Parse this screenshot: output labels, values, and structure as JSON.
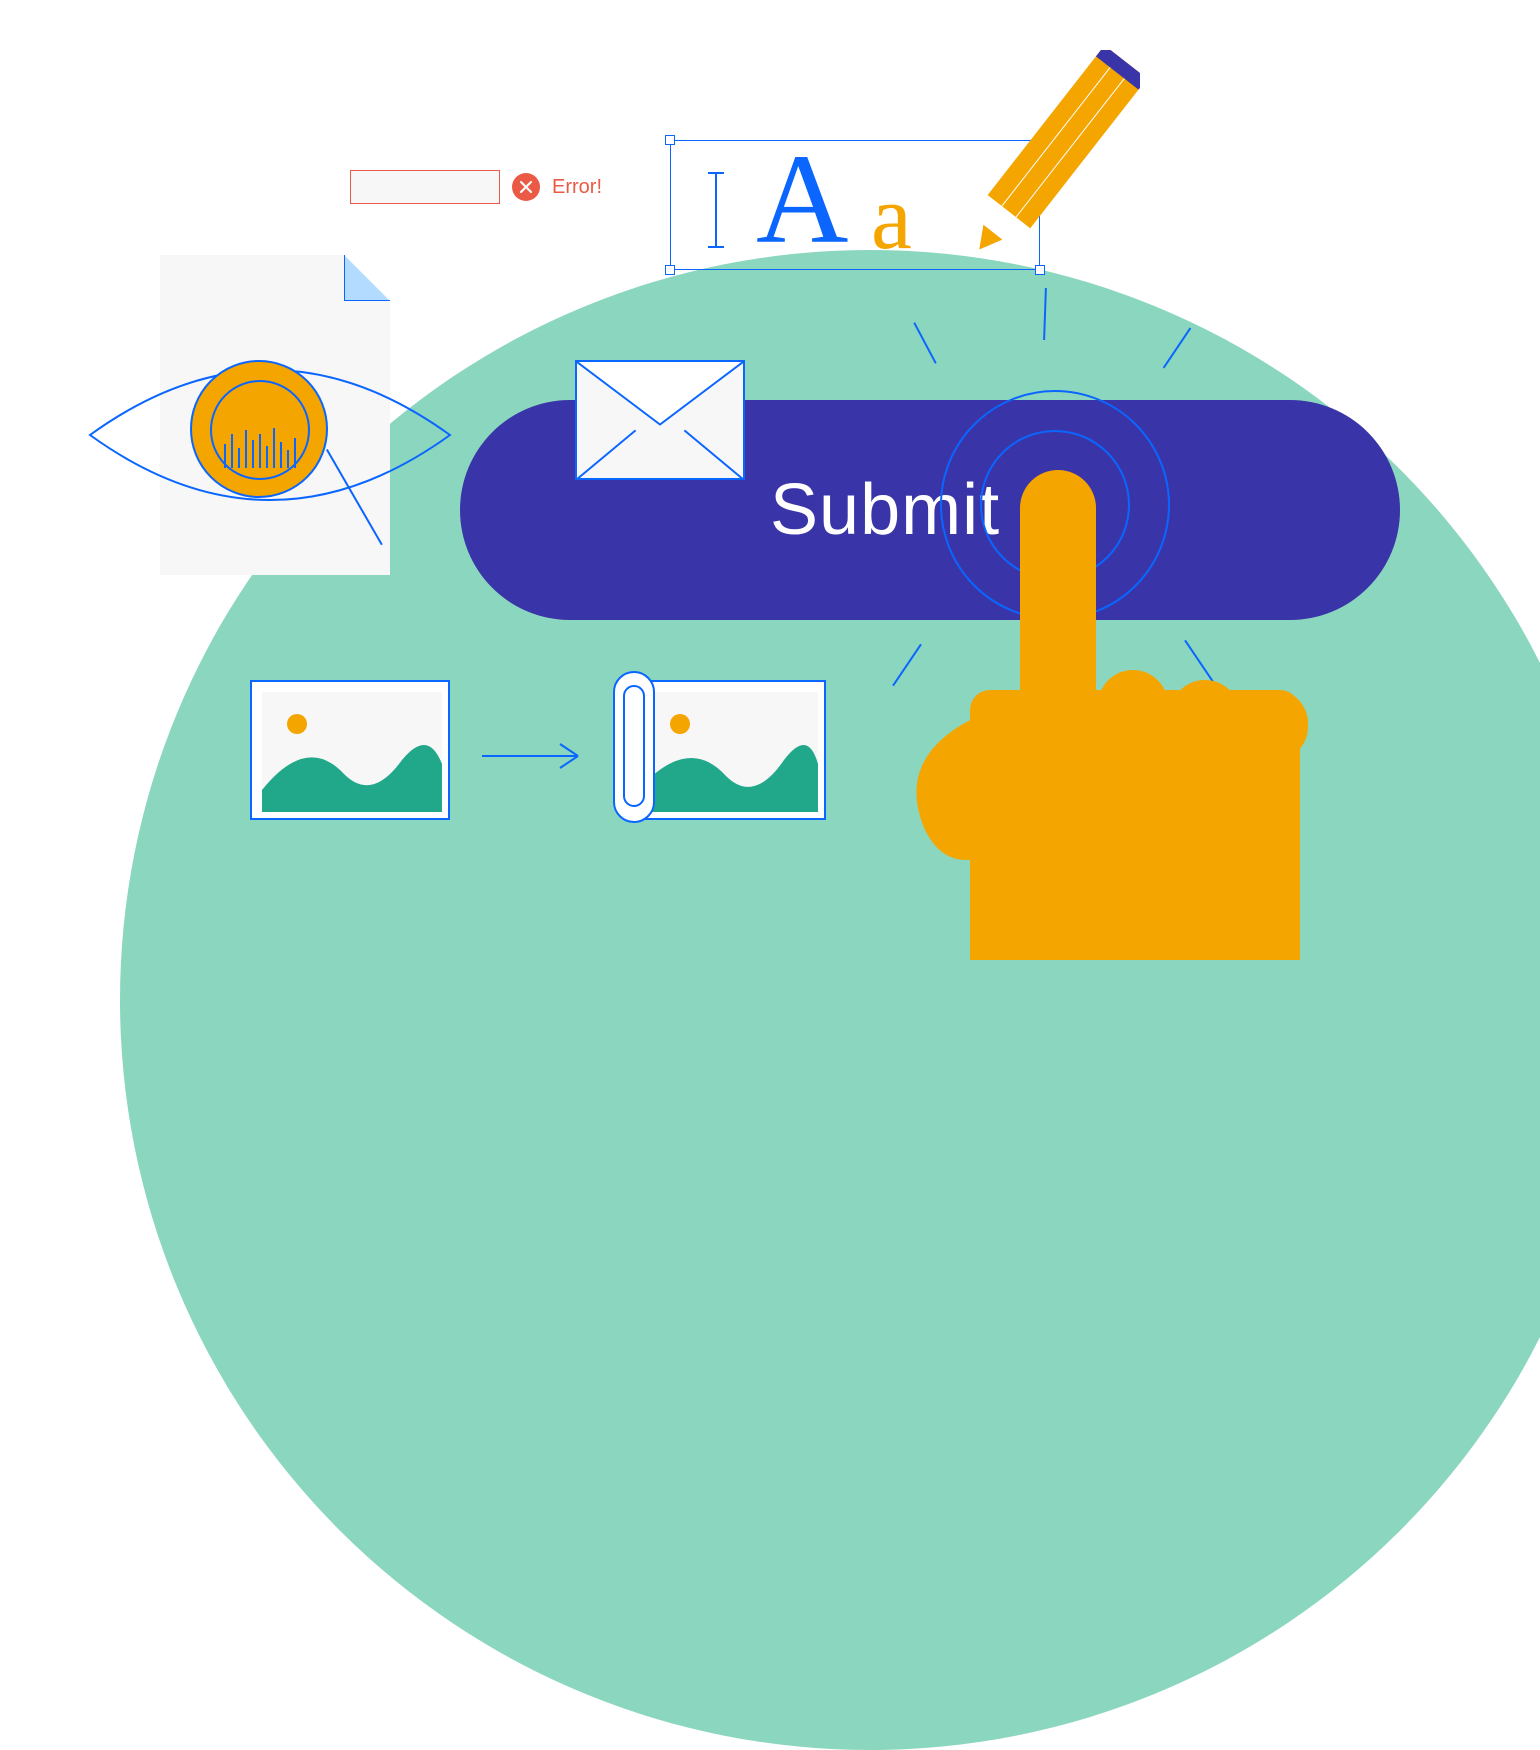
{
  "error": {
    "label": "Error!"
  },
  "text_edit": {
    "sample_upper": "A",
    "sample_lower": "a"
  },
  "submit": {
    "label": "Submit"
  },
  "colors": {
    "mint": "#8bd6bf",
    "blue": "#0a66ff",
    "indigo": "#3935a8",
    "amber": "#f5a500",
    "coral": "#ea5a44",
    "teal": "#21a78a"
  }
}
